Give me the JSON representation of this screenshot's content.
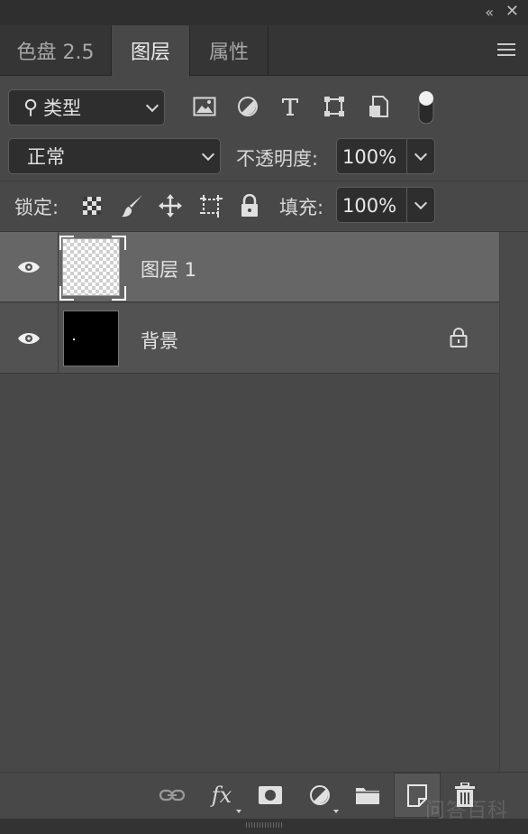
{
  "window": {
    "collapse_glyph": "«",
    "close_glyph": "✕"
  },
  "tabs": [
    {
      "label": "色盘 2.5",
      "active": false
    },
    {
      "label": "图层",
      "active": true
    },
    {
      "label": "属性",
      "active": false
    }
  ],
  "filter": {
    "kind_label": "类型",
    "icons": [
      "image-filter-icon",
      "adjustment-filter-icon",
      "type-filter-icon",
      "shape-filter-icon",
      "smart-object-filter-icon",
      "filter-toggle-switch"
    ]
  },
  "blend": {
    "mode": "正常",
    "opacity_label": "不透明度:",
    "opacity_value": "100%"
  },
  "lock": {
    "label": "锁定:",
    "fill_label": "填充:",
    "fill_value": "100%"
  },
  "layers": [
    {
      "name": "图层 1",
      "selected": true,
      "visible": true,
      "thumbnail": "transparent"
    },
    {
      "name": "背景",
      "selected": false,
      "visible": true,
      "thumbnail": "black",
      "locked": true
    }
  ],
  "toolbar": {
    "fx_label": "fx",
    "icons": [
      "link-layers-icon",
      "fx-icon",
      "add-mask-icon",
      "adjustment-layer-icon",
      "new-group-icon",
      "new-layer-icon",
      "delete-layer-icon"
    ]
  },
  "watermark": "问答百科",
  "colors": {
    "panel": "#484848",
    "selected_row": "#666666",
    "field": "#2e2e2e"
  }
}
